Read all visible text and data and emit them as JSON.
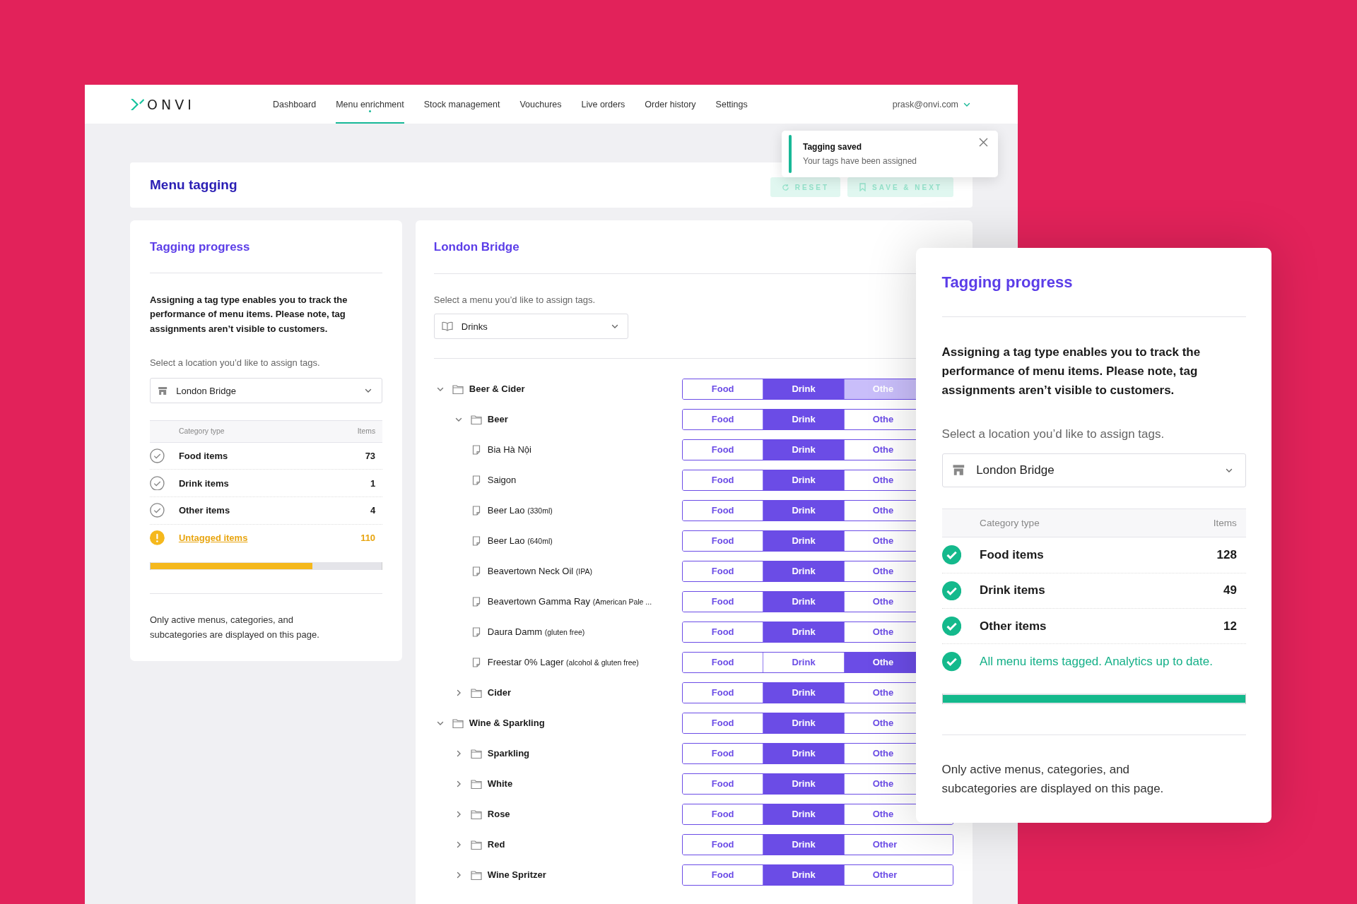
{
  "header": {
    "logo": "ONVI",
    "nav": [
      {
        "label": "Dashboard",
        "selected": false
      },
      {
        "label": "Menu enrichment",
        "selected": true
      },
      {
        "label": "Stock management",
        "selected": false
      },
      {
        "label": "Vouchures",
        "selected": false
      },
      {
        "label": "Live orders",
        "selected": false
      },
      {
        "label": "Order history",
        "selected": false
      },
      {
        "label": "Settings",
        "selected": false
      }
    ],
    "account": "prask@onvi.com"
  },
  "toast": {
    "title": "Tagging saved",
    "message": "Your tags have been assigned"
  },
  "page_title": "Menu tagging",
  "actions": [
    {
      "label": "RESET",
      "kind": "reset",
      "disabled": true
    },
    {
      "label": "SAVE & NEXT",
      "kind": "save",
      "disabled": true
    }
  ],
  "progress_panels": [
    {
      "title": "Tagging progress",
      "intro": "Assigning a tag type enables you to track the performance of menu items. Please note, tag assignments aren’t visible to customers.",
      "location_prompt": "Select a location you’d like to assign tags.",
      "location": "London Bridge",
      "columns": [
        "Category type",
        "Items"
      ],
      "rows": [
        {
          "label": "Food items",
          "count": "73",
          "checked": false,
          "kind": "count"
        },
        {
          "label": "Drink items",
          "count": "1",
          "checked": false,
          "kind": "count"
        },
        {
          "label": "Other items",
          "count": "4",
          "checked": false,
          "kind": "count"
        },
        {
          "label": "Untagged items",
          "count": "110",
          "checked": false,
          "kind": "link"
        }
      ],
      "level": 0.7,
      "footnote": "Only active menus, categories, and subcategories are displayed on this page."
    },
    {
      "title": "Tagging progress",
      "intro": "Assigning a tag type enables you to track the performance of menu items. Please note, tag assignments aren’t visible to customers.",
      "location_prompt": "Select a location you’d like to assign tags.",
      "location": "London Bridge",
      "columns": [
        "Category type",
        "Items"
      ],
      "rows": [
        {
          "label": "Food items",
          "count": "128",
          "checked": true,
          "kind": "count"
        },
        {
          "label": "Drink items",
          "count": "49",
          "checked": true,
          "kind": "count"
        },
        {
          "label": "Other items",
          "count": "12",
          "checked": true,
          "kind": "count"
        },
        {
          "label": "All menu items tagged. Analytics up to date.",
          "checked": true,
          "kind": "message"
        }
      ],
      "level": 1,
      "footnote": "Only active menus, categories, and subcategories are displayed on this page."
    }
  ],
  "menu_panel": {
    "title": "London Bridge",
    "prompt": "Select a menu you’d like to assign tags.",
    "menu": "Drinks",
    "tree": [
      {
        "name": "Beer & Cider",
        "kind": "folder",
        "expanded": true,
        "options": [
          {
            "label": "Food",
            "selected": false,
            "partial": false
          },
          {
            "label": "Drink",
            "selected": true,
            "partial": false
          },
          {
            "label": "Othe",
            "selected": false,
            "partial": true
          }
        ],
        "children": [
          {
            "name": "Beer",
            "kind": "folder",
            "expanded": true,
            "options": [
              {
                "label": "Food",
                "selected": false,
                "partial": false
              },
              {
                "label": "Drink",
                "selected": true,
                "partial": false
              },
              {
                "label": "Othe",
                "selected": false,
                "partial": false
              }
            ],
            "children": [
              {
                "name": "Bia Hà Nội",
                "kind": "item",
                "options": [
                  {
                    "label": "Food",
                    "selected": false,
                    "partial": false
                  },
                  {
                    "label": "Drink",
                    "selected": true,
                    "partial": false
                  },
                  {
                    "label": "Othe",
                    "selected": false,
                    "partial": false
                  }
                ]
              },
              {
                "name": "Saigon",
                "kind": "item",
                "options": [
                  {
                    "label": "Food",
                    "selected": false,
                    "partial": false
                  },
                  {
                    "label": "Drink",
                    "selected": true,
                    "partial": false
                  },
                  {
                    "label": "Othe",
                    "selected": false,
                    "partial": false
                  }
                ]
              },
              {
                "name": "Beer Lao",
                "note": "(330ml)",
                "kind": "item",
                "options": [
                  {
                    "label": "Food",
                    "selected": false,
                    "partial": false
                  },
                  {
                    "label": "Drink",
                    "selected": true,
                    "partial": false
                  },
                  {
                    "label": "Othe",
                    "selected": false,
                    "partial": false
                  }
                ]
              },
              {
                "name": "Beer Lao",
                "note": "(640ml)",
                "kind": "item",
                "options": [
                  {
                    "label": "Food",
                    "selected": false,
                    "partial": false
                  },
                  {
                    "label": "Drink",
                    "selected": true,
                    "partial": false
                  },
                  {
                    "label": "Othe",
                    "selected": false,
                    "partial": false
                  }
                ]
              },
              {
                "name": "Beavertown Neck Oil",
                "note": "(IPA)",
                "kind": "item",
                "options": [
                  {
                    "label": "Food",
                    "selected": false,
                    "partial": false
                  },
                  {
                    "label": "Drink",
                    "selected": true,
                    "partial": false
                  },
                  {
                    "label": "Othe",
                    "selected": false,
                    "partial": false
                  }
                ]
              },
              {
                "name": "Beavertown Gamma Ray",
                "note": "(American Pale ...",
                "kind": "item",
                "options": [
                  {
                    "label": "Food",
                    "selected": false,
                    "partial": false
                  },
                  {
                    "label": "Drink",
                    "selected": true,
                    "partial": false
                  },
                  {
                    "label": "Othe",
                    "selected": false,
                    "partial": false
                  }
                ]
              },
              {
                "name": "Daura Damm",
                "note": "(gluten free)",
                "kind": "item",
                "options": [
                  {
                    "label": "Food",
                    "selected": false,
                    "partial": false
                  },
                  {
                    "label": "Drink",
                    "selected": true,
                    "partial": false
                  },
                  {
                    "label": "Othe",
                    "selected": false,
                    "partial": false
                  }
                ]
              },
              {
                "name": "Freestar 0% Lager",
                "note": "(alcohol & gluten free)",
                "kind": "item",
                "options": [
                  {
                    "label": "Food",
                    "selected": false,
                    "partial": false
                  },
                  {
                    "label": "Drink",
                    "selected": false,
                    "partial": false
                  },
                  {
                    "label": "Othe",
                    "selected": true,
                    "partial": false
                  }
                ]
              }
            ]
          },
          {
            "name": "Cider",
            "kind": "folder",
            "expanded": false,
            "options": [
              {
                "label": "Food",
                "selected": false,
                "partial": false
              },
              {
                "label": "Drink",
                "selected": true,
                "partial": false
              },
              {
                "label": "Othe",
                "selected": false,
                "partial": false
              }
            ]
          }
        ]
      },
      {
        "name": "Wine & Sparkling",
        "kind": "folder",
        "expanded": true,
        "options": [
          {
            "label": "Food",
            "selected": false,
            "partial": false
          },
          {
            "label": "Drink",
            "selected": true,
            "partial": false
          },
          {
            "label": "Othe",
            "selected": false,
            "partial": false
          }
        ],
        "children": [
          {
            "name": "Sparkling",
            "kind": "folder",
            "expanded": false,
            "options": [
              {
                "label": "Food",
                "selected": false,
                "partial": false
              },
              {
                "label": "Drink",
                "selected": true,
                "partial": false
              },
              {
                "label": "Othe",
                "selected": false,
                "partial": false
              }
            ]
          },
          {
            "name": "White",
            "kind": "folder",
            "expanded": false,
            "options": [
              {
                "label": "Food",
                "selected": false,
                "partial": false
              },
              {
                "label": "Drink",
                "selected": true,
                "partial": false
              },
              {
                "label": "Othe",
                "selected": false,
                "partial": false
              }
            ]
          },
          {
            "name": "Rose",
            "kind": "folder",
            "expanded": false,
            "options": [
              {
                "label": "Food",
                "selected": false,
                "partial": false
              },
              {
                "label": "Drink",
                "selected": true,
                "partial": false
              },
              {
                "label": "Othe",
                "selected": false,
                "partial": false
              }
            ]
          },
          {
            "name": "Red",
            "kind": "folder",
            "expanded": false,
            "options": [
              {
                "label": "Food",
                "selected": false,
                "partial": false
              },
              {
                "label": "Drink",
                "selected": true,
                "partial": false
              },
              {
                "label": "Other",
                "selected": false,
                "partial": false
              }
            ]
          },
          {
            "name": "Wine Spritzer",
            "kind": "folder",
            "expanded": false,
            "options": [
              {
                "label": "Food",
                "selected": false,
                "partial": false
              },
              {
                "label": "Drink",
                "selected": true,
                "partial": false
              },
              {
                "label": "Other",
                "selected": false,
                "partial": false
              }
            ]
          }
        ]
      }
    ]
  }
}
